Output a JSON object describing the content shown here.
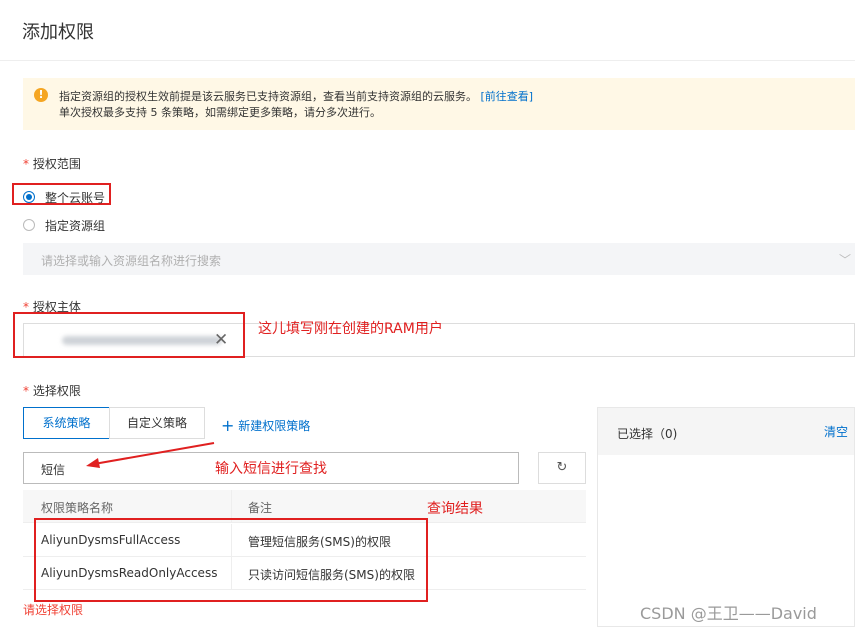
{
  "header": {
    "title": "添加权限"
  },
  "notice": {
    "line1": "指定资源组的授权生效前提是该云服务已支持资源组，查看当前支持资源组的云服务。",
    "link": "[前往查看]",
    "line2": "单次授权最多支持 5 条策略，如需绑定更多策略，请分多次进行。"
  },
  "scope": {
    "required_mark": "*",
    "label": "授权范围",
    "options": [
      "整个云账号",
      "指定资源组"
    ],
    "selected": "整个云账号",
    "resource_group_placeholder": "请选择或输入资源组名称进行搜索"
  },
  "principal": {
    "required_mark": "*",
    "label": "授权主体",
    "annotation": "这儿填写刚在创建的RAM用户"
  },
  "permissions": {
    "required_mark": "*",
    "label": "选择权限",
    "tabs": [
      "系统策略",
      "自定义策略"
    ],
    "active_tab": "系统策略",
    "new_policy": "新建权限策略",
    "search_value": "短信",
    "search_annotation": "输入短信进行查找",
    "result_annotation": "查询结果",
    "table": {
      "headers": [
        "权限策略名称",
        "备注"
      ],
      "rows": [
        {
          "name": "AliyunDysmsFullAccess",
          "note": "管理短信服务(SMS)的权限"
        },
        {
          "name": "AliyunDysmsReadOnlyAccess",
          "note": "只读访问短信服务(SMS)的权限"
        }
      ]
    },
    "error": "请选择权限"
  },
  "selected_panel": {
    "title": "已选择（0)",
    "clear": "清空"
  },
  "watermark": "CSDN @王卫——David",
  "colors": {
    "accent": "#0070cc",
    "annotation_red": "#e02020",
    "warning": "#f5a623",
    "notice_bg": "#fff8e6"
  },
  "icons": [
    "warning-icon",
    "close-icon",
    "chevron-down-icon",
    "plus-icon",
    "refresh-icon",
    "arrow-icon"
  ]
}
